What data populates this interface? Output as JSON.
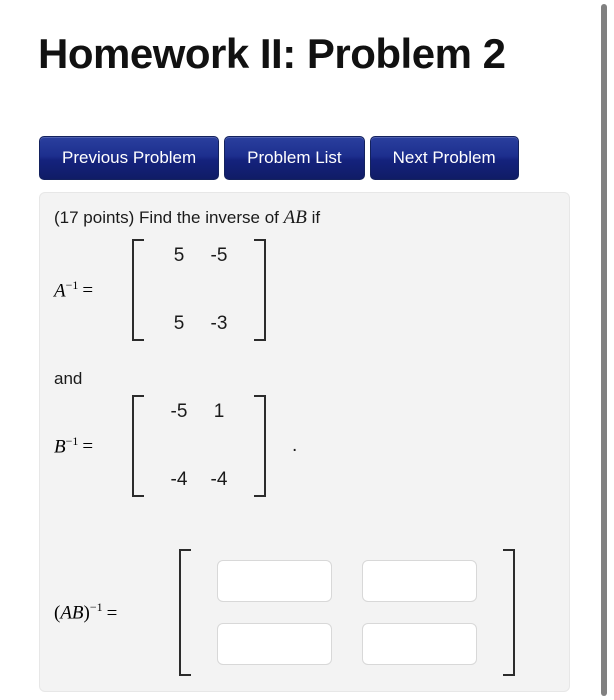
{
  "header": {
    "title": "Homework II: Problem 2"
  },
  "nav": {
    "buttons": [
      {
        "label": "Previous Problem",
        "name": "previous-problem-button"
      },
      {
        "label": "Problem List",
        "name": "problem-list-button"
      },
      {
        "label": "Next Problem",
        "name": "next-problem-button"
      }
    ]
  },
  "problem": {
    "points_text": "(17 points) Find the inverse of",
    "inline_expression": "AB",
    "prompt_suffix": "if",
    "conjunction": "and",
    "trailing_punctuation": ".",
    "equals": "=",
    "labels": {
      "a_inverse_base": "A",
      "a_inverse_exponent": "−1",
      "b_inverse_base": "B",
      "b_inverse_exponent": "−1",
      "ab_inverse_open": "(",
      "ab_inverse_base": "AB",
      "ab_inverse_close": ")",
      "ab_inverse_exponent": "−1"
    },
    "matrix_a_inverse": {
      "rows": [
        [
          "5",
          "-5"
        ],
        [
          "5",
          "-3"
        ]
      ]
    },
    "matrix_b_inverse": {
      "rows": [
        [
          "-5",
          "1"
        ],
        [
          "-4",
          "-4"
        ]
      ]
    },
    "answer_matrix": {
      "inputs": [
        {
          "value": "",
          "placeholder": ""
        },
        {
          "value": "",
          "placeholder": ""
        },
        {
          "value": "",
          "placeholder": ""
        },
        {
          "value": "",
          "placeholder": ""
        }
      ]
    }
  },
  "colors": {
    "button_blue": "#1d2f8e",
    "panel_background": "#f3f3f3",
    "text": "#1a1a1a",
    "scrollbar": "#808080"
  }
}
